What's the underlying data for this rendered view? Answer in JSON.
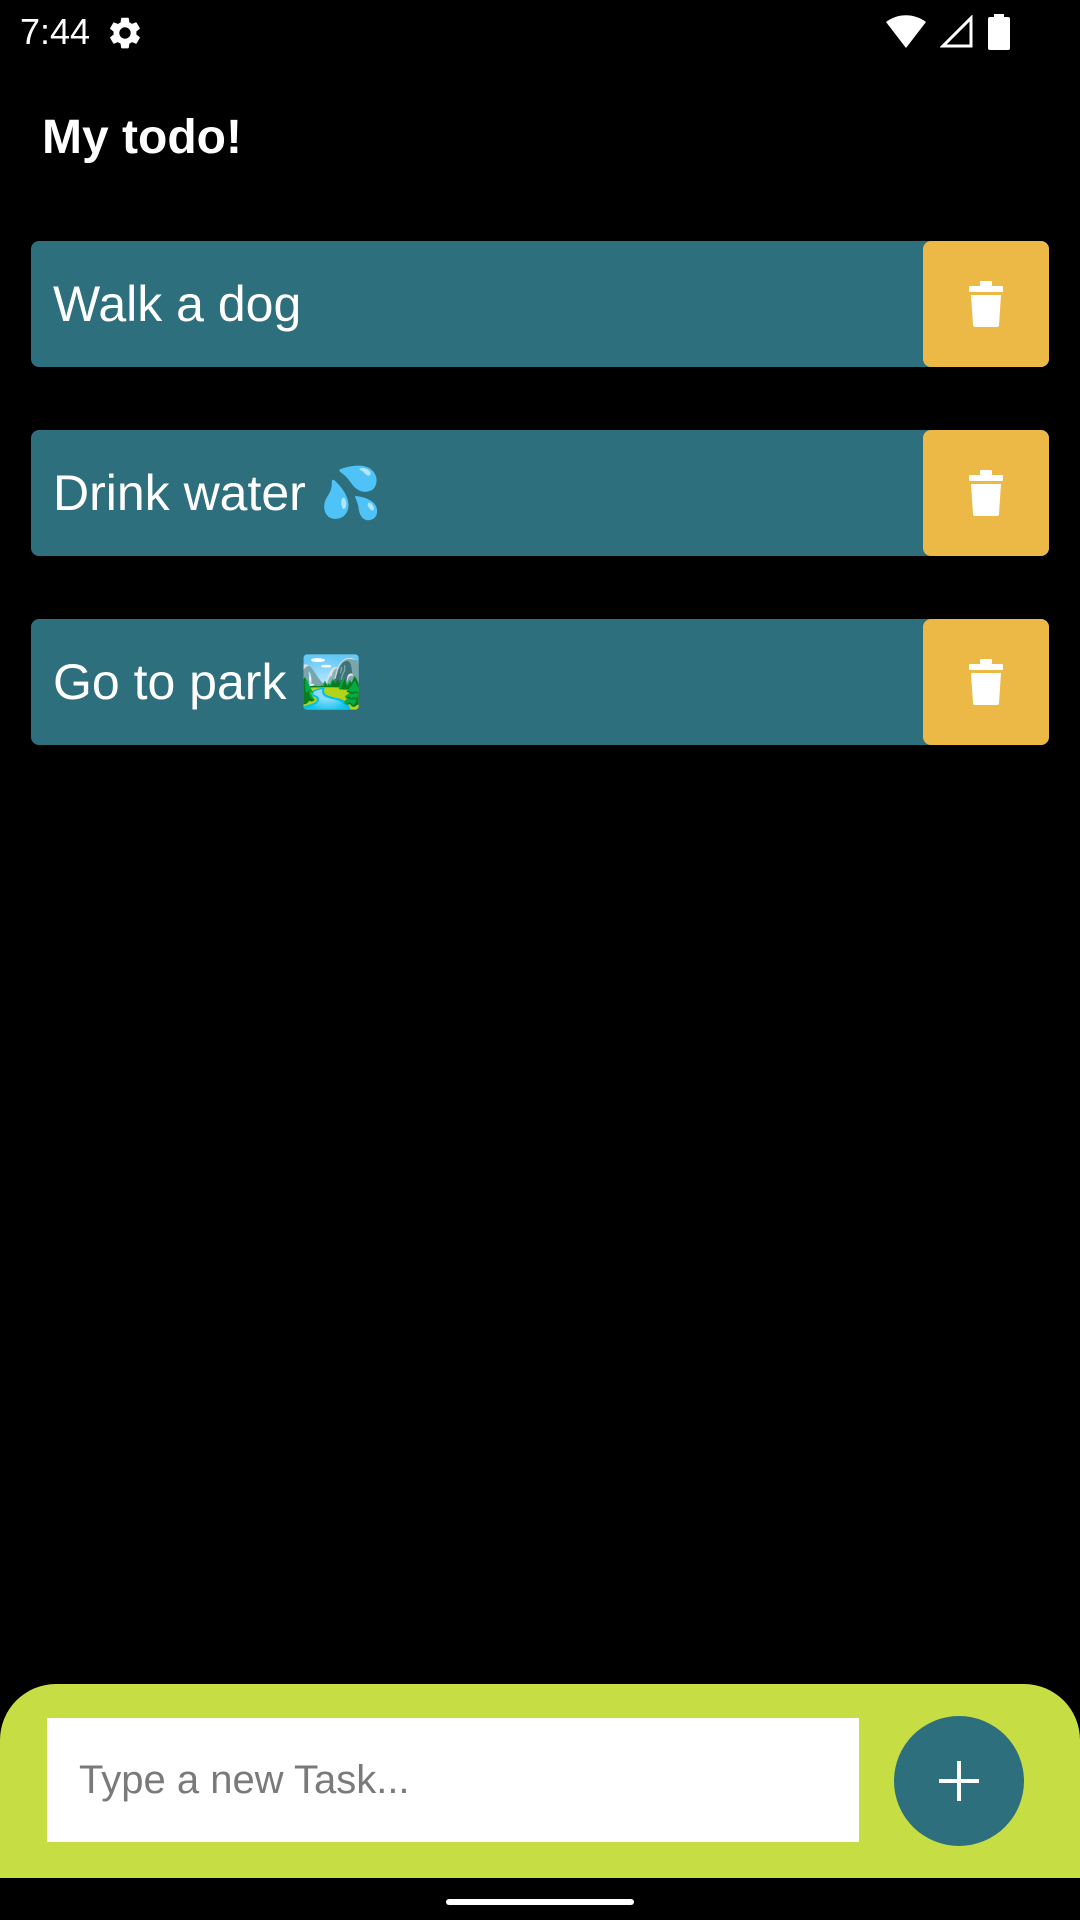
{
  "status_bar": {
    "time": "7:44",
    "icons": [
      "gear-icon",
      "wifi-icon",
      "cell-signal-icon",
      "battery-icon"
    ]
  },
  "app": {
    "title": "My todo!"
  },
  "tasks": [
    {
      "text": "Walk a dog",
      "delete_icon": "trash-icon"
    },
    {
      "text": "Drink water 💦",
      "delete_icon": "trash-icon"
    },
    {
      "text": "Go to park 🏞️",
      "delete_icon": "trash-icon"
    }
  ],
  "composer": {
    "placeholder": "Type a new Task...",
    "value": "",
    "add_icon": "plus-icon"
  },
  "colors": {
    "background": "#000000",
    "task_background": "#2e6f7e",
    "delete_button": "#ecb946",
    "panel": "#c6de44",
    "add_button": "#2e6f7e"
  }
}
